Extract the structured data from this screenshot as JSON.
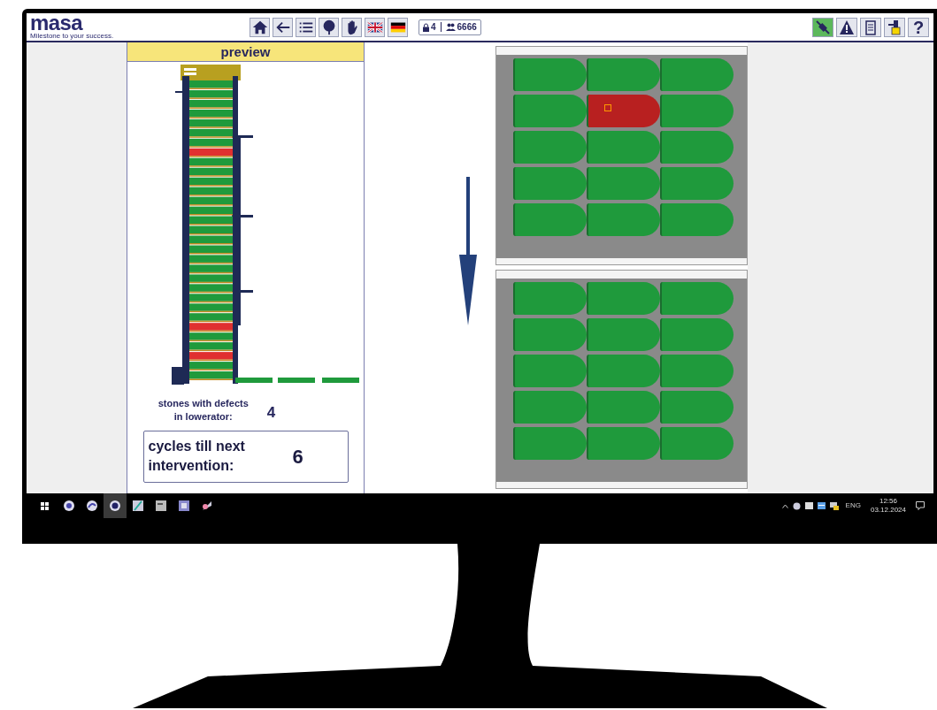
{
  "header": {
    "logo": "masa",
    "tagline": "Milestone to your success.",
    "session": {
      "access_level": "4",
      "user": "6666"
    },
    "connection": {
      "on": true
    },
    "help_label": "?"
  },
  "preview": {
    "title": "preview",
    "lowerator_levels": [
      {
        "defect": false
      },
      {
        "defect": false
      },
      {
        "defect": false
      },
      {
        "defect": false
      },
      {
        "defect": false
      },
      {
        "defect": false
      },
      {
        "defect": false
      },
      {
        "defect": true
      },
      {
        "defect": false
      },
      {
        "defect": false
      },
      {
        "defect": false
      },
      {
        "defect": false
      },
      {
        "defect": false
      },
      {
        "defect": false
      },
      {
        "defect": false
      },
      {
        "defect": false
      },
      {
        "defect": false
      },
      {
        "defect": false
      },
      {
        "defect": false
      },
      {
        "defect": false
      },
      {
        "defect": false
      },
      {
        "defect": false
      },
      {
        "defect": false
      },
      {
        "defect": false
      },
      {
        "defect": false
      },
      {
        "defect": true
      },
      {
        "defect": false
      },
      {
        "defect": false
      },
      {
        "defect": true
      },
      {
        "defect": false
      },
      {
        "defect": false
      }
    ],
    "defects_label": "stones with defects in lowerator:",
    "defects_count": "4",
    "cycles_label": "cycles till next intervention:",
    "cycles_count": "6"
  },
  "trays": [
    {
      "stones": [
        [
          {
            "defect": false
          },
          {
            "defect": false
          },
          {
            "defect": false
          }
        ],
        [
          {
            "defect": false
          },
          {
            "defect": true
          },
          {
            "defect": false
          }
        ],
        [
          {
            "defect": false
          },
          {
            "defect": false
          },
          {
            "defect": false
          }
        ],
        [
          {
            "defect": false
          },
          {
            "defect": false
          },
          {
            "defect": false
          }
        ],
        [
          {
            "defect": false
          },
          {
            "defect": false
          },
          {
            "defect": false
          }
        ]
      ]
    },
    {
      "stones": [
        [
          {
            "defect": false
          },
          {
            "defect": false
          },
          {
            "defect": false
          }
        ],
        [
          {
            "defect": false
          },
          {
            "defect": false
          },
          {
            "defect": false
          }
        ],
        [
          {
            "defect": false
          },
          {
            "defect": false
          },
          {
            "defect": false
          }
        ],
        [
          {
            "defect": false
          },
          {
            "defect": false
          },
          {
            "defect": false
          }
        ],
        [
          {
            "defect": false
          },
          {
            "defect": false
          },
          {
            "defect": false
          }
        ]
      ]
    }
  ],
  "taskbar": {
    "apps": [
      {
        "selected": false
      },
      {
        "selected": false
      },
      {
        "selected": true
      },
      {
        "selected": false
      },
      {
        "selected": false
      },
      {
        "selected": false
      },
      {
        "selected": false
      }
    ],
    "language": "ENG",
    "time": "12:56",
    "date": "03.12.2024"
  }
}
